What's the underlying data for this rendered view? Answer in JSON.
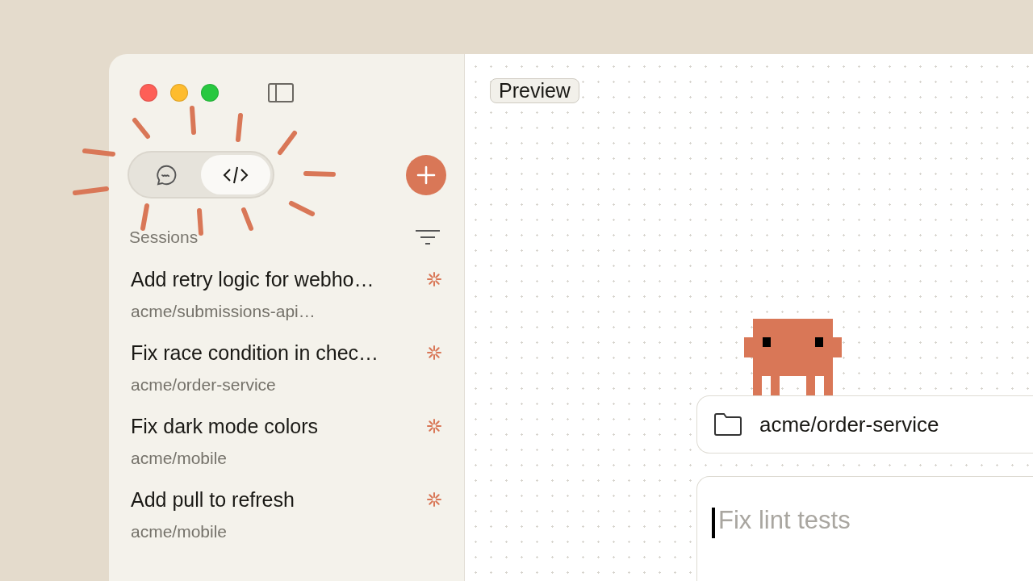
{
  "sidebar": {
    "mode_toggle": [
      {
        "kind": "chat",
        "selected": false
      },
      {
        "kind": "code",
        "selected": true
      }
    ],
    "section_title": "Sessions",
    "sessions": [
      {
        "title": "Add retry logic for webho…",
        "repo": "acme/submissions-api…",
        "running": true
      },
      {
        "title": "Fix race condition in chec…",
        "repo": "acme/order-service",
        "running": true
      },
      {
        "title": "Fix dark mode colors",
        "repo": "acme/mobile",
        "running": true
      },
      {
        "title": "Add pull to refresh",
        "repo": "acme/mobile",
        "running": true
      }
    ]
  },
  "main": {
    "preview_button": "Preview",
    "repo": "acme/order-service",
    "prompt": {
      "placeholder": "Fix lint tests"
    }
  }
}
